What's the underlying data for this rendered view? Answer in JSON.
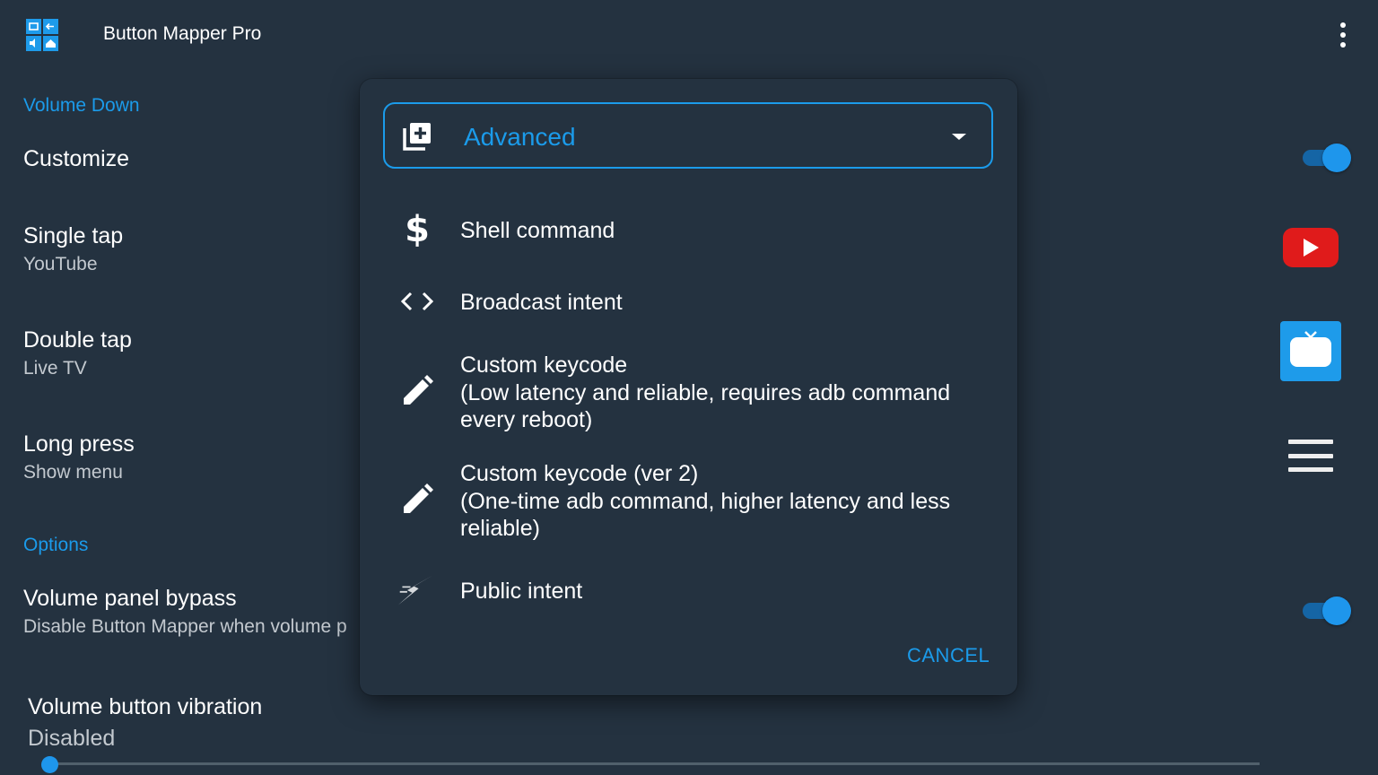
{
  "app": {
    "title": "Button Mapper Pro"
  },
  "settings": {
    "section_volume_down": "Volume Down",
    "customize": {
      "title": "Customize",
      "enabled": true
    },
    "single_tap": {
      "title": "Single tap",
      "value": "YouTube"
    },
    "double_tap": {
      "title": "Double tap",
      "value": "Live TV"
    },
    "long_press": {
      "title": "Long press",
      "value": "Show menu"
    },
    "section_options": "Options",
    "volume_panel_bypass": {
      "title": "Volume panel bypass",
      "subtitle": "Disable Button Mapper when volume p",
      "enabled": true
    },
    "volume_vibration": {
      "title": "Volume button vibration",
      "value": "Disabled",
      "level": 0
    }
  },
  "dialog": {
    "dropdown": {
      "selected": "Advanced",
      "icon": "add-to-queue-icon"
    },
    "options": [
      {
        "icon": "dollar-icon",
        "lines": [
          "Shell command"
        ]
      },
      {
        "icon": "code-brackets-icon",
        "lines": [
          "Broadcast intent"
        ]
      },
      {
        "icon": "pencil-icon",
        "lines": [
          "Custom keycode",
          "(Low latency and reliable, requires adb command",
          "every reboot)"
        ]
      },
      {
        "icon": "pencil-icon",
        "lines": [
          "Custom keycode (ver 2)",
          "(One-time adb command, higher latency and less",
          "reliable)"
        ]
      },
      {
        "icon": "lightning-icon",
        "lines": [
          "Public intent"
        ]
      }
    ],
    "cancel_label": "CANCEL"
  },
  "colors": {
    "background": "#243240",
    "accent": "#1b9bea",
    "youtube_red": "#e01b1b"
  }
}
